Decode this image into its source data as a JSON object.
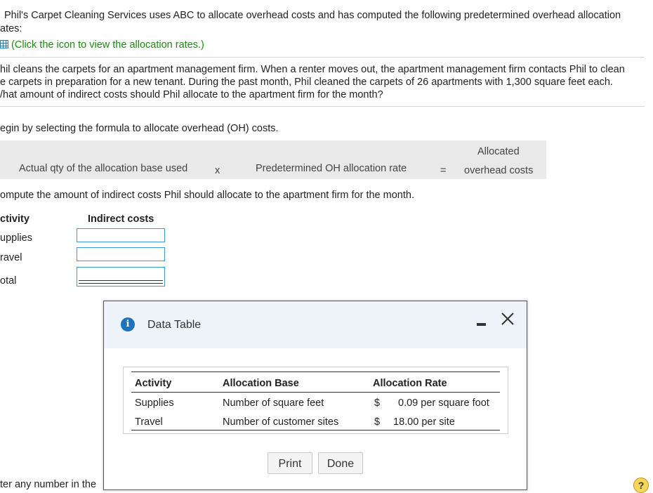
{
  "problem": {
    "intro_line1": "Phil's Carpet Cleaning Services uses ABC to allocate overhead costs and has computed the following predetermined overhead allocation",
    "intro_line2": "ates:",
    "link_text": "(Click the icon to view the allocation rates.)",
    "scenario_line1": "hil cleans the carpets for an apartment management firm. When a renter moves out, the apartment management firm contacts Phil to clean",
    "scenario_line2": "e carpets in preparation for a new tenant. During the past month, Phil cleaned the carpets of 26 apartments with 1,300 square feet each.",
    "scenario_line3": "/hat amount of indirect costs should Phil allocate to the apartment firm for the month?"
  },
  "formula": {
    "instruction": "egin by selecting the formula to allocate overhead (OH) costs.",
    "term1": "Actual qty of the allocation base used",
    "times": "x",
    "term2": "Predetermined OH allocation rate",
    "equals": "=",
    "result_line1": "Allocated",
    "result_line2": "overhead costs"
  },
  "compute": {
    "instruction": "ompute the amount of indirect costs Phil should allocate to the apartment firm for the month.",
    "col_activity": "ctivity",
    "col_indirect": "Indirect costs",
    "rows": [
      "upplies",
      "ravel",
      "otal"
    ]
  },
  "footer": {
    "hint": "ter any number in the"
  },
  "dialog": {
    "title": "Data Table",
    "headers": [
      "Activity",
      "Allocation Base",
      "Allocation Rate"
    ],
    "rows": [
      {
        "activity": "Supplies",
        "base": "Number of square feet",
        "currency": "$",
        "rate": "0.09 per square foot"
      },
      {
        "activity": "Travel",
        "base": "Number of customer sites",
        "currency": "$",
        "rate": "18.00 per site"
      }
    ],
    "print_label": "Print",
    "done_label": "Done"
  },
  "help": {
    "label": "?"
  }
}
